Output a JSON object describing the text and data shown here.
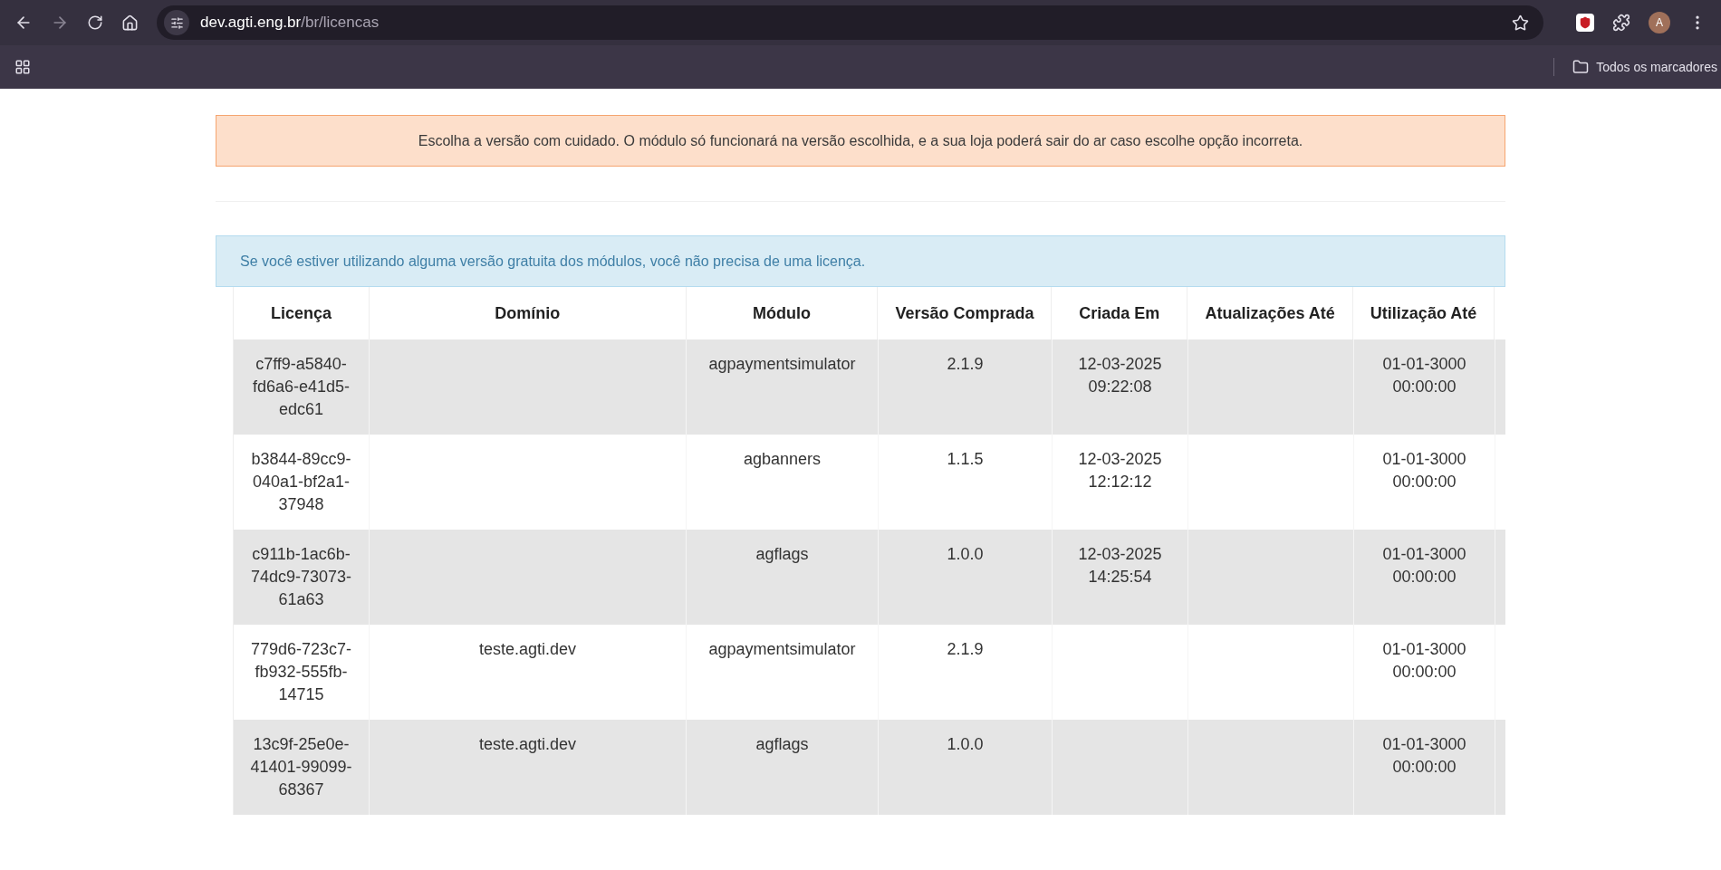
{
  "browser": {
    "url_host": "dev.agti.eng.br",
    "url_path": "/br/licencas",
    "profile_initial": "A",
    "bookmarks_folder": "Todos os marcadores"
  },
  "warning": "Escolha a versão com cuidado. O módulo só funcionará na versão escolhida, e a sua loja poderá sair do ar caso escolhe opção incorreta.",
  "info": "Se você estiver utilizando alguma versão gratuita dos módulos, você não precisa de uma licença.",
  "table": {
    "columns": [
      "Licença",
      "Domínio",
      "Módulo",
      "Versão Comprada",
      "Criada Em",
      "Atualizações Até",
      "Utilização Até"
    ],
    "rows": [
      {
        "cells": [
          "c7ff9-a5840-fd6a6-e41d5-edc61",
          "",
          "agpaymentsimulator",
          "2.1.9",
          "12-03-2025 09:22:08",
          "",
          "01-01-3000 00:00:00"
        ]
      },
      {
        "cells": [
          "b3844-89cc9-040a1-bf2a1-37948",
          "",
          "agbanners",
          "1.1.5",
          "12-03-2025 12:12:12",
          "",
          "01-01-3000 00:00:00"
        ]
      },
      {
        "cells": [
          "c911b-1ac6b-74dc9-73073-61a63",
          "",
          "agflags",
          "1.0.0",
          "12-03-2025 14:25:54",
          "",
          "01-01-3000 00:00:00"
        ]
      },
      {
        "cells": [
          "779d6-723c7-fb932-555fb-14715",
          "teste.agti.dev",
          "agpaymentsimulator",
          "2.1.9",
          "",
          "",
          "01-01-3000 00:00:00"
        ]
      },
      {
        "cells": [
          "13c9f-25e0e-41401-99099-68367",
          "teste.agti.dev",
          "agflags",
          "1.0.0",
          "",
          "",
          "01-01-3000 00:00:00"
        ]
      }
    ]
  }
}
